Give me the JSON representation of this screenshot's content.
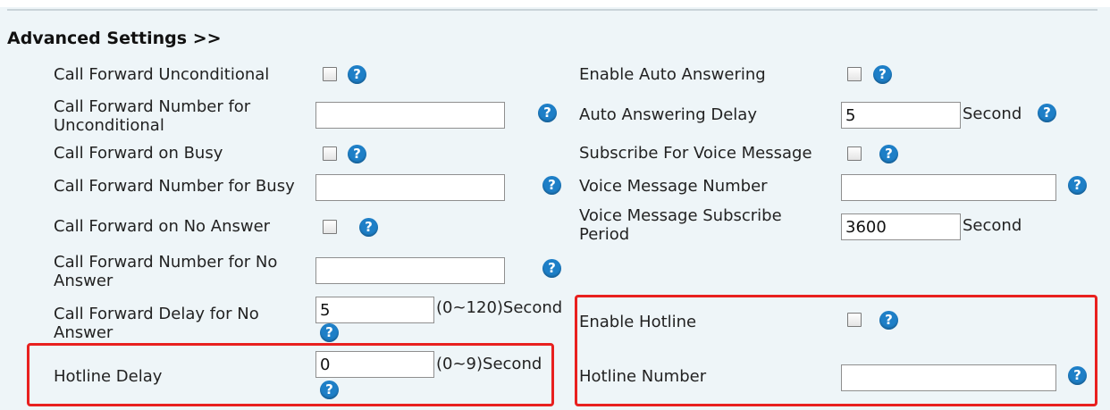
{
  "section_title": "Advanced Settings >>",
  "help_glyph": "?",
  "left": {
    "cf_unconditional": {
      "label": "Call Forward Unconditional"
    },
    "cf_number_unconditional": {
      "label": "Call Forward Number for Unconditional",
      "value": ""
    },
    "cf_busy": {
      "label": "Call Forward on Busy"
    },
    "cf_number_busy": {
      "label": "Call Forward Number for Busy",
      "value": ""
    },
    "cf_no_answer": {
      "label": "Call Forward on No Answer"
    },
    "cf_number_no_answer": {
      "label": "Call Forward Number for No Answer",
      "value": ""
    },
    "cf_delay_no_answer": {
      "label": "Call Forward Delay for No Answer",
      "value": "5",
      "unit": "(0~120)Second"
    },
    "hotline_delay": {
      "label": "Hotline Delay",
      "value": "0",
      "unit": "(0~9)Second"
    }
  },
  "right": {
    "auto_answering": {
      "label": "Enable Auto Answering"
    },
    "auto_answering_delay": {
      "label": "Auto Answering Delay",
      "value": "5",
      "unit": "Second"
    },
    "subscribe_voice_message": {
      "label": "Subscribe For Voice Message"
    },
    "voice_message_number": {
      "label": "Voice Message Number",
      "value": ""
    },
    "voice_message_period": {
      "label": "Voice Message Subscribe Period",
      "value": "3600",
      "unit": "Second"
    },
    "enable_hotline": {
      "label": "Enable Hotline"
    },
    "hotline_number": {
      "label": "Hotline Number",
      "value": ""
    }
  },
  "colors": {
    "highlight": "#e8201f",
    "help_icon": "#1e7fc7",
    "background": "#eef5f8"
  }
}
